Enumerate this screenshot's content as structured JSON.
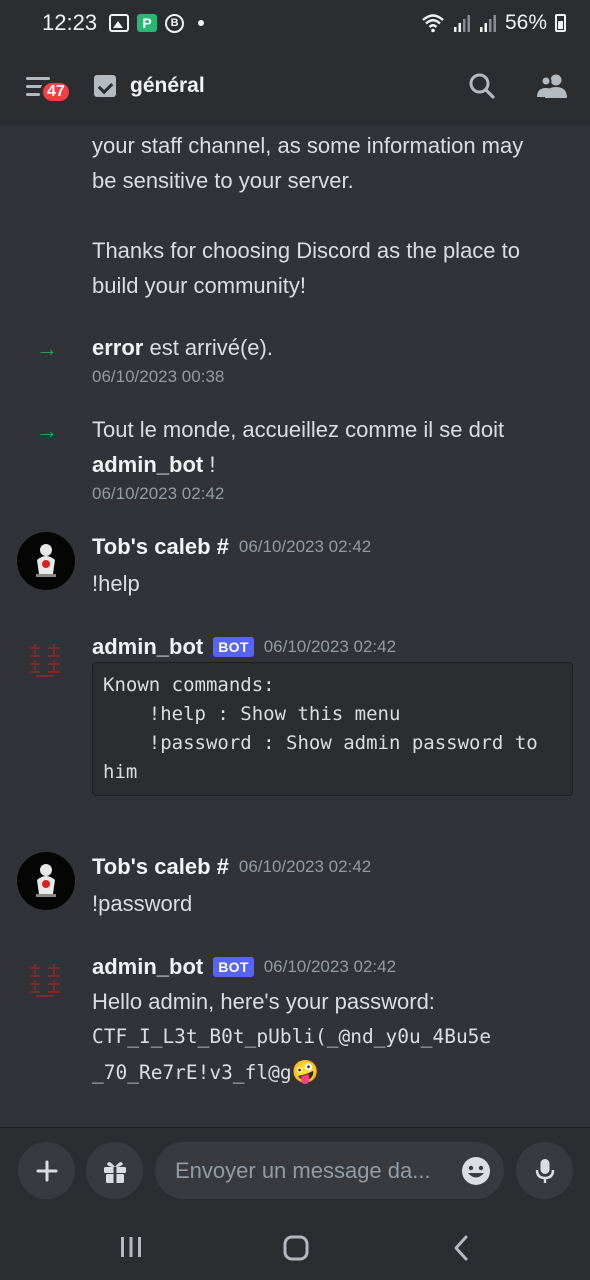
{
  "status_bar": {
    "time": "12:23",
    "battery": "56%"
  },
  "header": {
    "notification_count": "47",
    "channel_name": "général"
  },
  "messages": {
    "intro_line1": "your staff channel, as some information may",
    "intro_line2": "be sensitive to your server.",
    "thanks_line1": "Thanks for choosing Discord as the place to",
    "thanks_line2": "build your community!",
    "join1": {
      "user": "error",
      "text": " est arrivé(e).",
      "timestamp": "06/10/2023 00:38"
    },
    "join2": {
      "text": "Tout le monde, accueillez comme il se doit",
      "user": "admin_bot",
      "suffix": " !",
      "timestamp": "06/10/2023 02:42"
    },
    "msg1": {
      "author": "Tob's caleb #",
      "timestamp": "06/10/2023 02:42",
      "content": "!help"
    },
    "msg2": {
      "author": "admin_bot",
      "bot_tag": "BOT",
      "timestamp": "06/10/2023 02:42",
      "code": "Known commands:\n    !help : Show this menu\n    !password : Show admin password to him"
    },
    "msg3": {
      "author": "Tob's caleb #",
      "timestamp": "06/10/2023 02:42",
      "content": "!password"
    },
    "msg4": {
      "author": "admin_bot",
      "bot_tag": "BOT",
      "timestamp": "06/10/2023 02:42",
      "content": "Hello admin, here's your password:",
      "code_line1": "CTF_I_L3t_B0t_pUbli(_@nd_y0u_4Bu5e",
      "code_line2": "_70_Re7rE!v3_fl@g",
      "emoji": "🤪"
    }
  },
  "composer": {
    "placeholder": "Envoyer un message da..."
  },
  "colors": {
    "background": "#313338",
    "bar": "#2b2d31",
    "bot_tag": "#5865f2",
    "badge": "#f23f43",
    "join_arrow": "#23a55a"
  }
}
